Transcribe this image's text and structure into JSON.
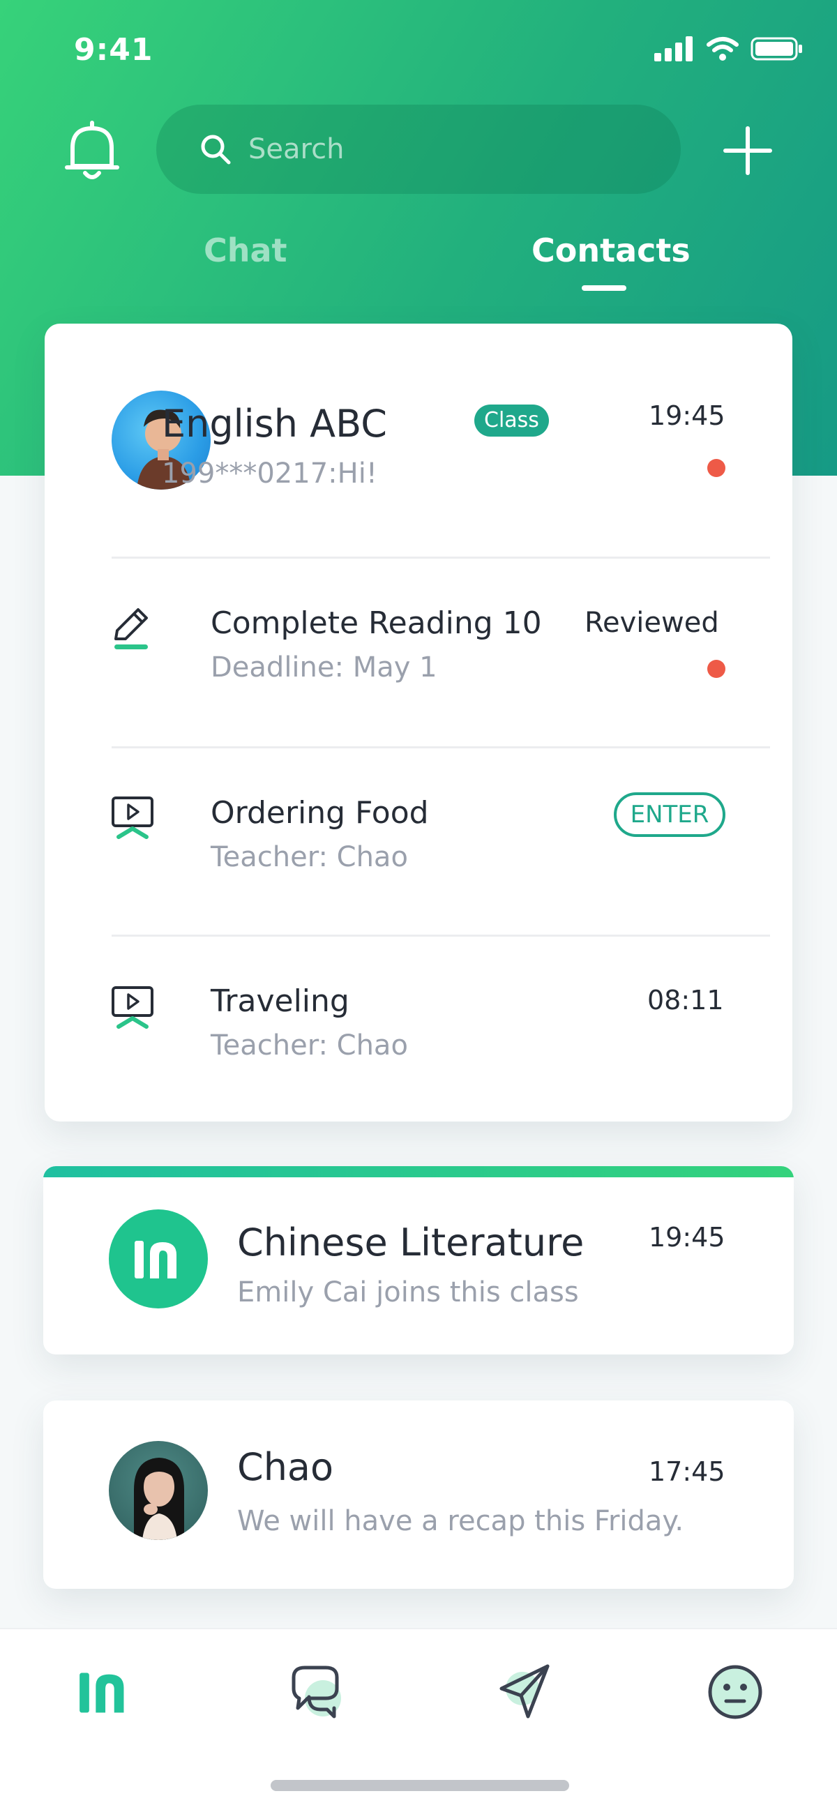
{
  "status_bar": {
    "time": "9:41"
  },
  "header": {
    "search_placeholder": "Search",
    "tabs": [
      {
        "label": "Chat",
        "active": false
      },
      {
        "label": "Contacts",
        "active": true
      }
    ]
  },
  "class_card": {
    "name": "English ABC",
    "badge": "Class",
    "last_message": "199***0217:Hi!",
    "time": "19:45",
    "unread": true,
    "items": [
      {
        "icon": "pencil-icon",
        "title": "Complete Reading 10",
        "subtitle": "Deadline: May 1",
        "status": "Reviewed",
        "unread": true
      },
      {
        "icon": "video-lesson-icon",
        "title": "Ordering Food",
        "subtitle": "Teacher: Chao",
        "action": "ENTER"
      },
      {
        "icon": "video-lesson-icon",
        "title": "Traveling",
        "subtitle": "Teacher: Chao",
        "time": "08:11"
      }
    ]
  },
  "conversations": [
    {
      "avatar": "app-logo-in",
      "name": "Chinese Literature",
      "message": "Emily Cai joins this class",
      "time": "19:45"
    },
    {
      "avatar": "user-photo",
      "name": "Chao",
      "message": "We will have a recap this Friday.",
      "time": "17:45"
    }
  ],
  "tabbar": {
    "items": [
      {
        "icon": "home-logo-icon",
        "active": true
      },
      {
        "icon": "chat-bubbles-icon",
        "active": false
      },
      {
        "icon": "send-icon",
        "active": false
      },
      {
        "icon": "smiley-icon",
        "active": false
      }
    ]
  },
  "colors": {
    "accent": "#1fa88b",
    "brand_green": "#34d27c",
    "unread_dot": "#ee5a47"
  }
}
